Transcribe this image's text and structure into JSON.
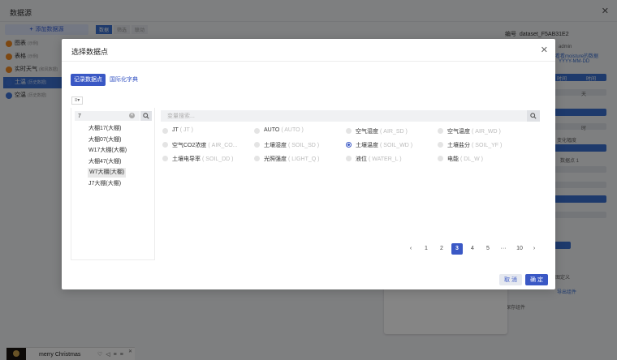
{
  "background": {
    "title": "数据源",
    "add_button": "添加数据源",
    "sidebar": [
      {
        "label": "图表",
        "sub": "(示例)"
      },
      {
        "label": "表格",
        "sub": "(示例)"
      },
      {
        "label": "实时天气",
        "sub": "(和风数据)"
      },
      {
        "label": "土温",
        "sub": "(历史数据)",
        "active": true
      },
      {
        "label": "空温",
        "sub": "(历史数据)"
      }
    ],
    "tabs": [
      "数据",
      "筛选",
      "联动"
    ],
    "right": {
      "id_label": "编号",
      "id_value": "dataset_F5AB31E2",
      "format": "YYYY-MM-DD",
      "admin": "admin",
      "moisture": "看看moisture的数据"
    },
    "misc": [
      "时间",
      "时间",
      "天",
      "时",
      "变化幅度",
      "数据点 1",
      "图定义",
      "导出组件",
      "保存组件"
    ]
  },
  "player": {
    "song": "merry Christmas"
  },
  "modal": {
    "title": "选择数据点",
    "tabs": {
      "active": "记录数据点",
      "other": "国际化字典"
    },
    "left_search_value": "7",
    "tree": [
      "大棚17(大棚)",
      "大棚07(大棚)",
      "W17大棚(大棚)",
      "大棚47(大棚)",
      "W7大棚(大棚)",
      "J7大棚(大棚)"
    ],
    "selected_tree_index": 4,
    "right_search_placeholder": "变量搜索...",
    "options": [
      {
        "label": "JT",
        "code": "( JT )"
      },
      {
        "label": "AUTO",
        "code": "( AUTO )"
      },
      {
        "label": "空气湿度",
        "code": "( AIR_SD )"
      },
      {
        "label": "空气温度",
        "code": "( AIR_WD )"
      },
      {
        "label": "空气CO2浓度",
        "code": "( AIR_CO..."
      },
      {
        "label": "土壤湿度",
        "code": "( SOIL_SD )"
      },
      {
        "label": "土壤温度",
        "code": "( SOIL_WD )"
      },
      {
        "label": "土壤盐分",
        "code": "( SOIL_YF )"
      },
      {
        "label": "土壤电导率",
        "code": "( SOIL_DD )"
      },
      {
        "label": "光照强度",
        "code": "( LIGHT_Q )"
      },
      {
        "label": "液位",
        "code": "( WATER_L )"
      },
      {
        "label": "电能",
        "code": "( DL_W )"
      }
    ],
    "checked_index": 6,
    "pagination": {
      "prev": "‹",
      "pages": [
        "1",
        "2",
        "3",
        "4",
        "5"
      ],
      "ellipsis": "···",
      "last": "10",
      "next": "›",
      "current": "3"
    },
    "buttons": {
      "cancel": "取 消",
      "ok": "确 定"
    }
  }
}
